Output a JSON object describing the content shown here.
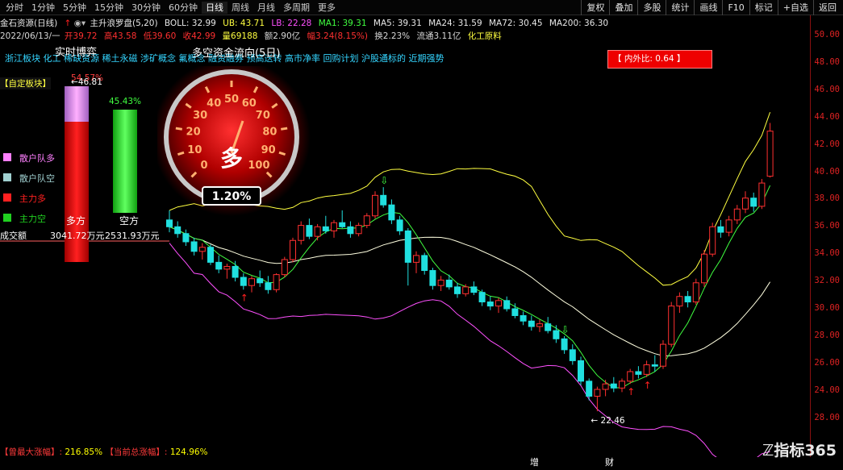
{
  "toolbar": {
    "periods": [
      "分时",
      "1分钟",
      "5分钟",
      "15分钟",
      "30分钟",
      "60分钟",
      "日线",
      "周线",
      "月线",
      "多周期",
      "更多"
    ],
    "active_period": "日线",
    "actions": [
      "复权",
      "叠加",
      "多股",
      "统计",
      "画线",
      "F10",
      "标记",
      "+自选",
      "返回"
    ]
  },
  "stock": {
    "name": "金石资源(日线)",
    "indicator": "主升浪罗盘(5,20)",
    "boll": "BOLL: 32.99",
    "ub": "UB: 43.71",
    "lb": "LB: 22.28",
    "ma1": "MA1: 39.31",
    "ma5": "MA5: 39.31",
    "ma24": "MA24: 31.59",
    "ma72": "MA72: 30.45",
    "ma200": "MA200: 36.30"
  },
  "quote": {
    "date": "2022/06/13/一",
    "open": "开39.72",
    "high": "高43.58",
    "low": "低39.60",
    "close": "收42.99",
    "vol": "量69188",
    "amount": "额2.90亿",
    "change": "幅3.24(8.15%)",
    "turnover": "换2.23%",
    "float": "流通3.11亿",
    "industry": "化工原料"
  },
  "concepts": "浙江板块 化工 稀缺资源 稀土永磁 涉矿概念 氟概念 融资融券 预高送转 高市净率 回购计划 沪股通标的 近期强势",
  "overlay": {
    "realtime_title": "实时博弈",
    "flow_title": "多空资金流向(5日)",
    "custom_block": "【自定板块】",
    "buy_pct": "54.57%",
    "sell_pct": "45.43%",
    "legend": [
      "散户队多",
      "散户队空",
      "主力多",
      "主力空"
    ],
    "buy_label": "多方",
    "sell_label": "空方",
    "volume_label": "成交额",
    "buy_amount": "3041.72万元",
    "sell_amount": "2531.93万元",
    "gauge_center": "多",
    "gauge_value": "1.20%",
    "gauge_ticks": [
      "0",
      "10",
      "20",
      "30",
      "40",
      "50",
      "60",
      "70",
      "80",
      "90",
      "100"
    ],
    "level_label": "46.81"
  },
  "ratio_button": "【 内外比: 0.64 】",
  "price_axis": [
    "50.00",
    "48.00",
    "46.00",
    "44.00",
    "42.00",
    "40.00",
    "38.00",
    "36.00",
    "34.00",
    "32.00",
    "30.00",
    "28.00",
    "26.00",
    "24.00",
    "28.00"
  ],
  "chart_data": {
    "type": "candlestick",
    "low_marker": "22.46",
    "ohlc": [
      [
        36.5,
        37.2,
        35.6,
        36.0
      ],
      [
        36.0,
        36.4,
        35.2,
        35.5
      ],
      [
        35.5,
        35.8,
        34.6,
        34.9
      ],
      [
        34.9,
        35.2,
        33.9,
        34.2
      ],
      [
        34.2,
        34.8,
        33.6,
        34.5
      ],
      [
        34.5,
        34.7,
        33.2,
        33.4
      ],
      [
        33.4,
        33.9,
        32.6,
        32.9
      ],
      [
        32.9,
        33.3,
        32.2,
        33.1
      ],
      [
        33.1,
        33.5,
        32.0,
        32.3
      ],
      [
        32.3,
        32.6,
        31.4,
        31.7
      ],
      [
        31.7,
        32.4,
        31.2,
        32.2
      ],
      [
        32.2,
        32.8,
        31.6,
        31.9
      ],
      [
        31.9,
        32.4,
        31.1,
        31.4
      ],
      [
        31.4,
        32.6,
        31.2,
        32.5
      ],
      [
        32.5,
        33.8,
        32.3,
        33.6
      ],
      [
        33.6,
        35.2,
        33.4,
        35.0
      ],
      [
        35.0,
        36.4,
        34.7,
        36.1
      ],
      [
        36.1,
        36.6,
        35.1,
        35.3
      ],
      [
        35.3,
        36.2,
        35.0,
        36.0
      ],
      [
        36.0,
        36.8,
        35.5,
        35.7
      ],
      [
        35.7,
        36.5,
        35.2,
        36.3
      ],
      [
        36.3,
        37.2,
        35.9,
        36.0
      ],
      [
        36.0,
        36.4,
        35.2,
        35.5
      ],
      [
        35.5,
        36.3,
        35.3,
        36.1
      ],
      [
        36.1,
        37.0,
        35.9,
        36.8
      ],
      [
        36.8,
        38.6,
        36.6,
        38.3
      ],
      [
        38.3,
        38.9,
        37.4,
        37.6
      ],
      [
        37.6,
        38.0,
        36.2,
        36.5
      ],
      [
        36.5,
        36.8,
        35.4,
        35.7
      ],
      [
        35.7,
        35.9,
        31.7,
        33.4
      ],
      [
        33.4,
        34.2,
        32.6,
        33.9
      ],
      [
        33.9,
        34.1,
        32.5,
        32.8
      ],
      [
        32.8,
        33.0,
        31.4,
        31.7
      ],
      [
        31.7,
        32.4,
        31.3,
        32.1
      ],
      [
        32.1,
        32.5,
        31.4,
        31.6
      ],
      [
        31.6,
        31.9,
        30.8,
        31.1
      ],
      [
        31.1,
        31.8,
        30.9,
        31.6
      ],
      [
        31.6,
        32.0,
        31.0,
        31.2
      ],
      [
        31.2,
        31.4,
        30.2,
        30.5
      ],
      [
        30.5,
        30.9,
        29.9,
        30.2
      ],
      [
        30.2,
        30.8,
        29.7,
        30.6
      ],
      [
        30.6,
        30.9,
        29.8,
        30.0
      ],
      [
        30.0,
        30.4,
        29.3,
        29.5
      ],
      [
        29.5,
        29.8,
        28.8,
        29.1
      ],
      [
        29.1,
        29.5,
        28.4,
        28.7
      ],
      [
        28.7,
        29.2,
        28.3,
        28.9
      ],
      [
        28.9,
        29.4,
        28.2,
        28.4
      ],
      [
        28.4,
        28.8,
        27.5,
        27.8
      ],
      [
        27.8,
        28.0,
        26.7,
        27.0
      ],
      [
        27.0,
        27.4,
        25.9,
        26.2
      ],
      [
        26.2,
        26.5,
        24.4,
        24.7
      ],
      [
        24.7,
        24.9,
        23.3,
        23.6
      ],
      [
        23.6,
        24.3,
        22.5,
        24.1
      ],
      [
        24.1,
        24.8,
        23.6,
        24.5
      ],
      [
        24.5,
        25.0,
        23.9,
        24.2
      ],
      [
        24.2,
        24.9,
        23.9,
        24.7
      ],
      [
        24.7,
        25.6,
        24.5,
        25.4
      ],
      [
        25.4,
        25.8,
        24.9,
        25.2
      ],
      [
        25.2,
        26.2,
        25.0,
        25.9
      ],
      [
        25.9,
        26.6,
        25.4,
        25.8
      ],
      [
        25.8,
        27.7,
        25.6,
        27.4
      ],
      [
        27.4,
        30.5,
        27.2,
        30.2
      ],
      [
        30.2,
        31.2,
        29.7,
        30.9
      ],
      [
        30.9,
        31.3,
        30.1,
        30.5
      ],
      [
        30.5,
        32.2,
        30.3,
        31.9
      ],
      [
        31.9,
        34.3,
        31.6,
        34.0
      ],
      [
        34.0,
        36.3,
        33.8,
        36.0
      ],
      [
        36.0,
        36.5,
        35.2,
        35.6
      ],
      [
        35.6,
        36.8,
        35.3,
        36.5
      ],
      [
        36.5,
        37.6,
        36.2,
        37.3
      ],
      [
        37.3,
        38.6,
        37.0,
        38.1
      ],
      [
        38.1,
        38.5,
        37.1,
        37.5
      ],
      [
        37.5,
        39.5,
        37.3,
        39.2
      ],
      [
        39.7,
        43.6,
        39.6,
        43.0
      ]
    ]
  }
}
